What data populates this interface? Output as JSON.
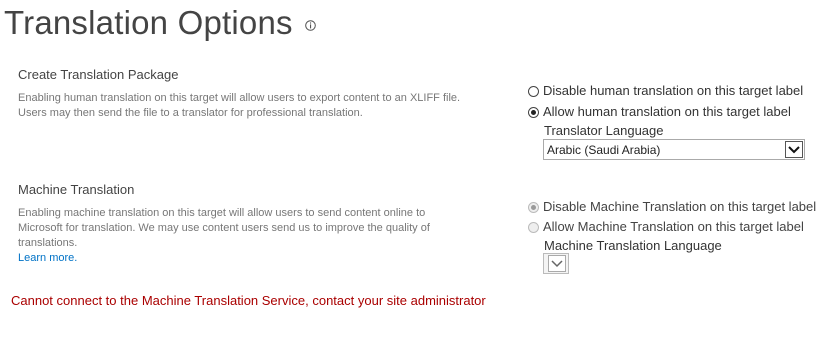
{
  "page": {
    "title": "Translation Options"
  },
  "package": {
    "title": "Create Translation Package",
    "desc_lines": [
      "Enabling human translation on this target will allow users to export content to an XLIFF file.",
      "Users may then send the file to a translator for professional translation."
    ],
    "options": [
      {
        "label": "Disable human translation on this target label",
        "checked": false
      },
      {
        "label": "Allow human translation on this target label",
        "checked": true
      }
    ],
    "language_label": "Translator Language",
    "language_value": "Arabic (Saudi Arabia)"
  },
  "machine": {
    "title": "Machine Translation",
    "desc_lines": [
      "Enabling machine translation on this target will allow users to send content online to",
      "Microsoft for translation. We may use content users send us to improve the quality of",
      "translations."
    ],
    "learn_more": "Learn more.",
    "options": [
      {
        "label": "Disable Machine Translation on this target label",
        "checked": true
      },
      {
        "label": "Allow Machine Translation on this target label",
        "checked": false
      }
    ],
    "language_label": "Machine Translation Language",
    "language_value": ""
  },
  "error": "Cannot connect to the Machine Translation Service, contact your site administrator",
  "colors": {
    "error": "#aa0000",
    "link": "#0072c6"
  }
}
